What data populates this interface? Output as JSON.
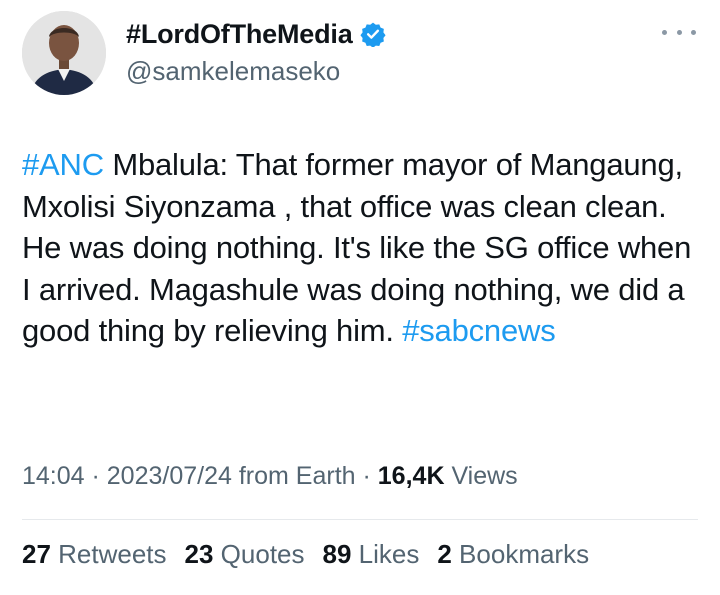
{
  "author": {
    "display_name": "#LordOfTheMedia",
    "handle": "@samkelemaseko",
    "avatar_icon": "profile-photo",
    "verified_icon": "verified-badge-icon",
    "verified_color": "#1d9bf0"
  },
  "tweet": {
    "hashtag_1": "#ANC",
    "body": " Mbalula: That former mayor of Mangaung, Mxolisi Siyonzama , that office was clean clean. He was doing nothing. It's like the SG office when I arrived. Magashule was doing nothing, we did a good thing by relieving him. ",
    "hashtag_2": "#sabcnews",
    "link_color": "#1d9bf0"
  },
  "meta": {
    "time": "14:04",
    "sep1": " · ",
    "date": "2023/07/24",
    "source": " from Earth",
    "sep2": " · ",
    "views_count": "16,4K",
    "views_label": " Views"
  },
  "stats": {
    "retweets_count": "27",
    "retweets_label": " Retweets",
    "quotes_count": "23",
    "quotes_label": " Quotes",
    "likes_count": "89",
    "likes_label": " Likes",
    "bookmarks_count": "2",
    "bookmarks_label": " Bookmarks"
  },
  "colors": {
    "text_primary": "#0f1419",
    "text_secondary": "#536471",
    "divider": "#e6e9ec"
  }
}
